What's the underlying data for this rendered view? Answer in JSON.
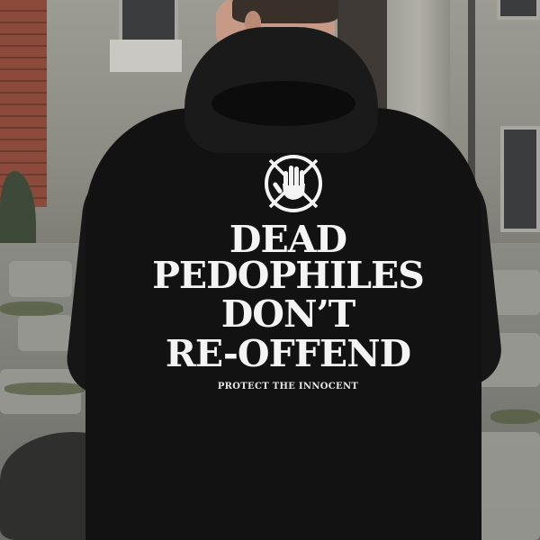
{
  "print": {
    "line1": "DEAD",
    "line2": "PEDOPHILES",
    "line3": "DON’T",
    "line4": "RE-OFFEND",
    "tagline": "PROTECT THE INNOCENT",
    "logo_icon": "crossed-hand-circle-icon"
  },
  "colors": {
    "hoodie": "#121212",
    "print_text": "#f4f4f4"
  }
}
